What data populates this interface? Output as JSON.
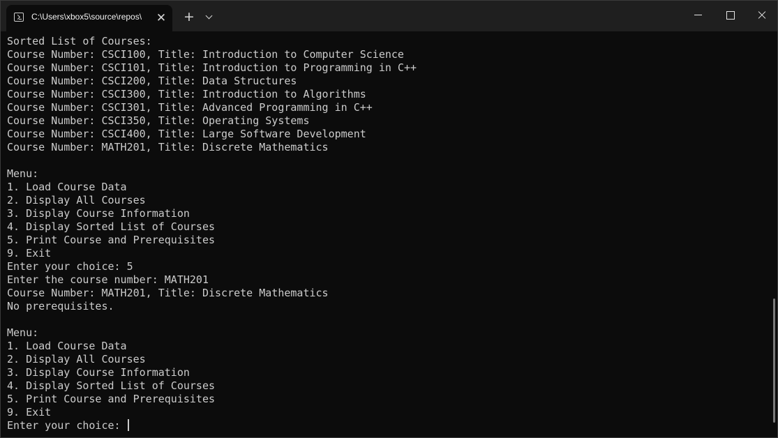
{
  "window": {
    "tab_title": "C:\\Users\\xbox5\\source\\repos\\",
    "tab_close": "✕",
    "new_tab": "+"
  },
  "console": {
    "lines": [
      "Sorted List of Courses:",
      "Course Number: CSCI100, Title: Introduction to Computer Science",
      "Course Number: CSCI101, Title: Introduction to Programming in C++",
      "Course Number: CSCI200, Title: Data Structures",
      "Course Number: CSCI300, Title: Introduction to Algorithms",
      "Course Number: CSCI301, Title: Advanced Programming in C++",
      "Course Number: CSCI350, Title: Operating Systems",
      "Course Number: CSCI400, Title: Large Software Development",
      "Course Number: MATH201, Title: Discrete Mathematics",
      "",
      "Menu:",
      "1. Load Course Data",
      "2. Display All Courses",
      "3. Display Course Information",
      "4. Display Sorted List of Courses",
      "5. Print Course and Prerequisites",
      "9. Exit",
      "Enter your choice: 5",
      "Enter the course number: MATH201",
      "Course Number: MATH201, Title: Discrete Mathematics",
      "No prerequisites.",
      "",
      "Menu:",
      "1. Load Course Data",
      "2. Display All Courses",
      "3. Display Course Information",
      "4. Display Sorted List of Courses",
      "5. Print Course and Prerequisites",
      "9. Exit",
      "Enter your choice: "
    ]
  },
  "colors": {
    "background": "#0c0c0c",
    "titlebar": "#1f1f1f",
    "text": "#cccccc"
  }
}
